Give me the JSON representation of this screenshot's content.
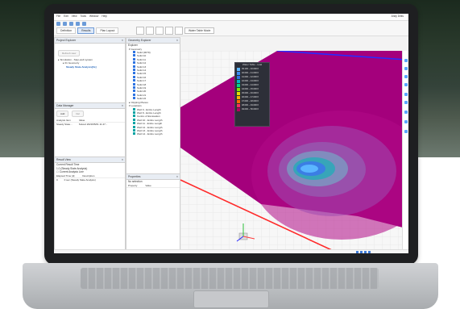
{
  "menu": [
    "File",
    "Edit",
    "View",
    "Tools",
    "Window",
    "Help"
  ],
  "user": "Andy Dirks",
  "tabs": [
    "Definition",
    "Results",
    "Plan Layout"
  ],
  "toolbar": {
    "water_table_label": "Water Table Mode"
  },
  "project_explorer": {
    "title": "Project Explorer",
    "button": "Refresh view",
    "items": [
      "Simulation - Step-well system",
      "01 Geometry",
      "Steady State Analysis[0s]"
    ]
  },
  "data_manager": {
    "title": "Data Manager",
    "add_label": "Add",
    "del_label": "Del",
    "col1": "Analysis Item",
    "col2": "Value",
    "row_name": "Steady State...",
    "row_value": "Solved 2023/05/01 11:47..."
  },
  "result_view": {
    "title": "Result View",
    "current_label": "Current Result Time",
    "current_value": "1.0 (Steady State Analysis)",
    "checkbox_label": "Current Analysis Line",
    "col1": "Elapsed Time [d]",
    "col2": "Description",
    "row_time": "0",
    "row_desc": "0 sec (Steady State Analysis)"
  },
  "geometry_explorer": {
    "title": "Geometry Explorer",
    "subheader": "Explorer",
    "groups": [
      "Geometry",
      "Clipping Planes",
      "Locations"
    ],
    "items": [
      "Solid (0070)",
      "Solid 10",
      "Solid 11",
      "Solid 12",
      "Solid 13",
      "Solid 14",
      "Solid 15",
      "Solid 16",
      "Solid 17",
      "Solid 18",
      "Solid 19",
      "Solid 20",
      "Solid 21",
      "Solid 22",
      "Well 9 - Entire Length",
      "Well 8 - Entire Length",
      "Centre of Excavation",
      "Well 10 - Entire Length",
      "Well 11 - Entire Length",
      "Well 12 - Entire Length",
      "Well 13 - Entire Length",
      "Well 14 - Entire Length"
    ]
  },
  "properties": {
    "title": "Properties",
    "subtitle": "No selection",
    "col1": "Property",
    "col2": "Value"
  },
  "legend": {
    "title": "Water Table - total",
    "rows": [
      {
        "label": "39.100 ~ 40.000 ft",
        "color": "#5bb6ff"
      },
      {
        "label": "40.000 ~ 41.000 ft",
        "color": "#3a8df2"
      },
      {
        "label": "41.000 ~ 42.000 ft",
        "color": "#2e74e2"
      },
      {
        "label": "42.000 ~ 43.000 ft",
        "color": "#00b7c8"
      },
      {
        "label": "43.000 ~ 44.000 ft",
        "color": "#00d98a"
      },
      {
        "label": "44.000 ~ 45.000 ft",
        "color": "#7fe600"
      },
      {
        "label": "45.000 ~ 46.000 ft",
        "color": "#e6dd00"
      },
      {
        "label": "46.000 ~ 47.000 ft",
        "color": "#ffb000"
      },
      {
        "label": "47.000 ~ 48.000 ft",
        "color": "#ff6b00"
      },
      {
        "label": "48.000 ~ 49.000 ft",
        "color": "#ff2a5f"
      },
      {
        "label": "49.000 ~ 50.000 ft",
        "color": "#b3005e"
      }
    ]
  },
  "colors": {
    "surface": "#a4007c",
    "surface_dark": "#6e0052",
    "axis_red": "#ff2a2a",
    "axis_blue": "#2a2aff"
  }
}
